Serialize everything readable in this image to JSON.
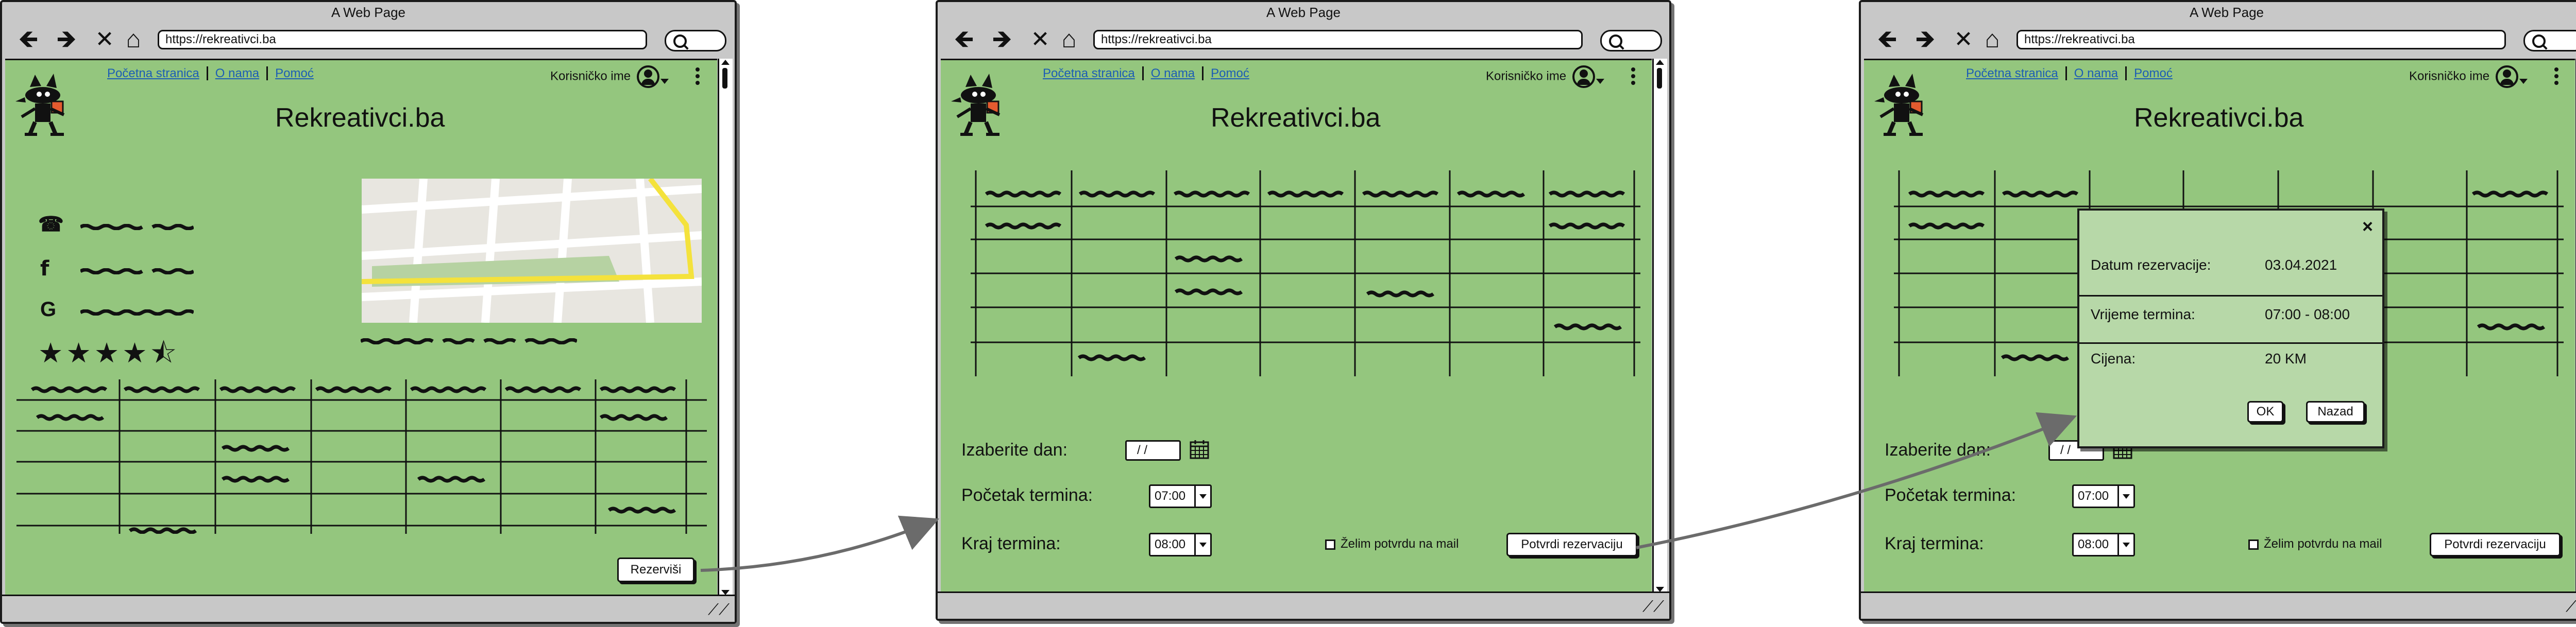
{
  "window_title": "A Web Page",
  "url": "https://rekreativci.ba",
  "nav": {
    "back": "🡸",
    "forward": "🡺",
    "close": "✕",
    "home": "⌂"
  },
  "links": [
    "Početna stranica",
    "O nama",
    "Pomoć"
  ],
  "user_label": "Korisničko ime",
  "site_title": "Rekreativci.ba",
  "rating": "★★★★⯪",
  "reserve_button": "Rezerviši",
  "form": {
    "date_label": "Izaberite dan:",
    "date_value": "/  /",
    "start_label": "Početak termina:",
    "start_value": "07:00",
    "end_label": "Kraj termina:",
    "end_value": "08:00",
    "email_confirm": "Želim potvrdu na mail",
    "confirm_button": "Potvrdi rezervaciju"
  },
  "dialog": {
    "close": "×",
    "date_label": "Datum rezervacije:",
    "date_value": "03.04.2021",
    "time_label": "Vrijeme termina:",
    "time_value": "07:00 - 08:00",
    "price_label": "Cijena:",
    "price_value": "20 KM",
    "ok": "OK",
    "back": "Nazad"
  },
  "colors": {
    "content_bg": "#94c67e",
    "chrome": "#c8c8c8",
    "link": "#1c5db5",
    "dialog_bg": "#b7d8a8"
  }
}
